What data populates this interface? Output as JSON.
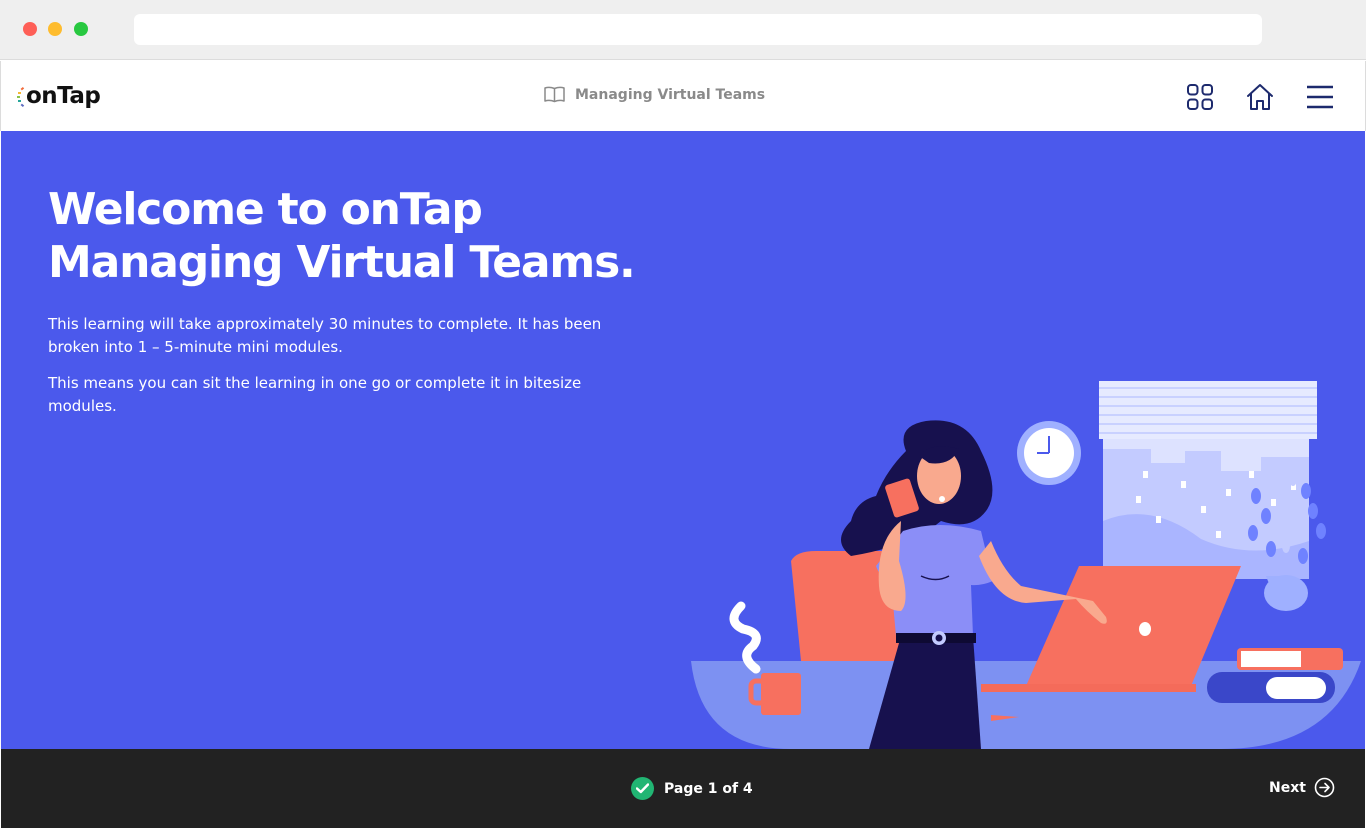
{
  "brand": {
    "logo_text": "onTap"
  },
  "header": {
    "course_title": "Managing Virtual Teams",
    "icons": [
      "book-icon",
      "grid-icon",
      "home-icon",
      "hamburger-menu-icon"
    ]
  },
  "content": {
    "headline_line1": "Welcome to onTap",
    "headline_line2": "Managing Virtual Teams.",
    "paragraph1": "This learning will take approximately 30 minutes to complete. It has been broken into 1 – 5-minute mini modules.",
    "paragraph2": "This means you can sit the learning in one go or complete it in bitesize modules."
  },
  "footer": {
    "page_indicator": "Page 1 of 4",
    "next_label": "Next",
    "icons": [
      "check-circle-icon",
      "arrow-right-circle-icon"
    ]
  },
  "colors": {
    "primary_bg": "#4b59ec",
    "footer_bg": "#222222",
    "accent_coral": "#f7705f",
    "success_green": "#21b573",
    "navy": "#1d2a6d"
  }
}
